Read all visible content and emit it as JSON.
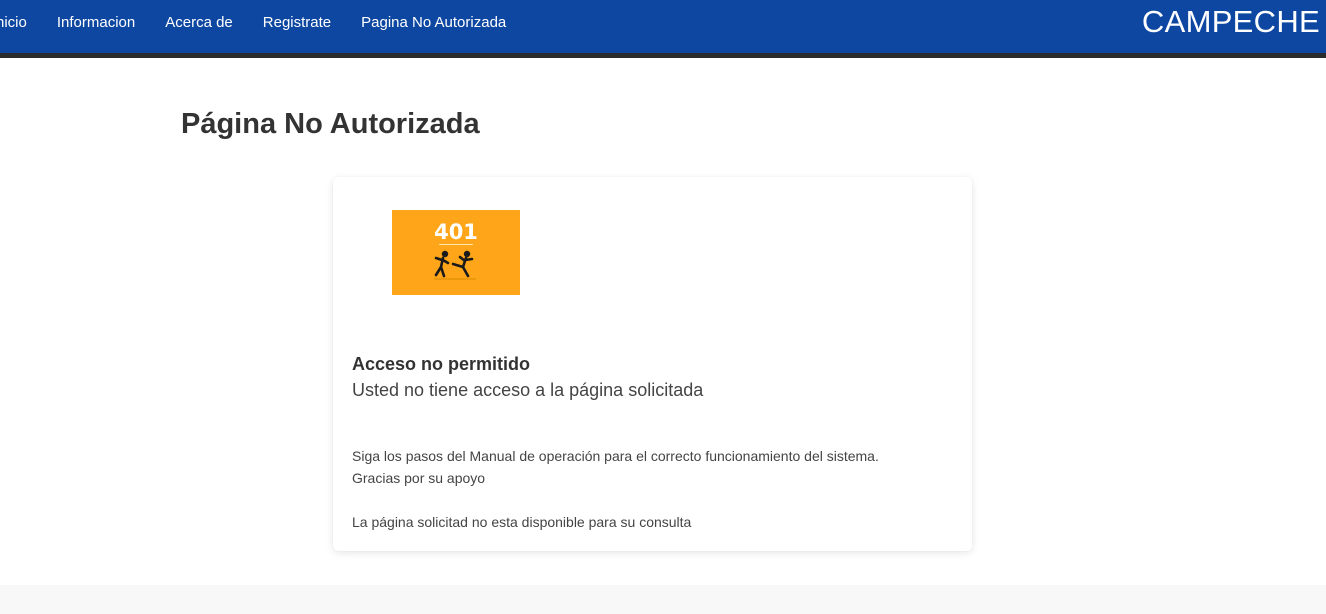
{
  "nav": {
    "items": [
      {
        "label": "nicio"
      },
      {
        "label": "Informacion"
      },
      {
        "label": "Acerca de"
      },
      {
        "label": "Registrate"
      },
      {
        "label": "Pagina No Autorizada"
      }
    ],
    "brand": "CAMPECHE"
  },
  "page": {
    "title": "Página No Autorizada"
  },
  "card": {
    "image_code": "401",
    "image_color": "#ffa51a",
    "heading": "Acceso no permitido",
    "subheading": "Usted no tiene acceso a la página solicitada",
    "message_line1": "Siga los pasos del Manual de operación para el correcto funcionamiento del sistema.",
    "message_line2": "Gracias por su apoyo",
    "message_line3": "La página solicitad no esta disponible para su consulta"
  },
  "colors": {
    "navbar": "#0d47a1",
    "navbar_border": "#2b2b2b"
  }
}
